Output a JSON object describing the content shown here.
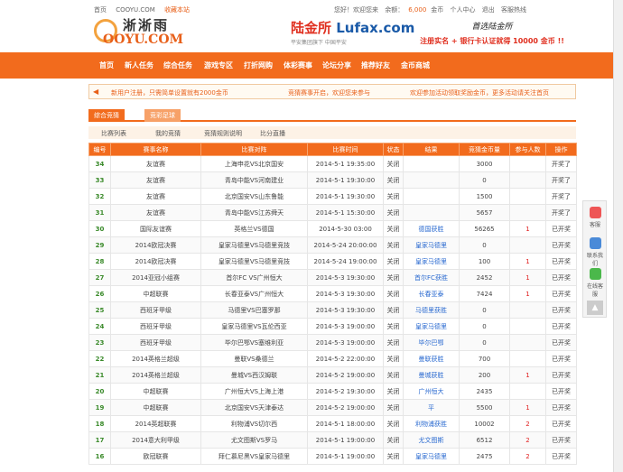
{
  "topbar": {
    "left": [
      "首页",
      "COOYU.COM",
      "收藏本站"
    ],
    "right": [
      "您好！欢迎您来",
      "余额：",
      "6,000",
      "金币",
      "个人中心",
      "退出",
      "客服热线"
    ]
  },
  "logo": {
    "cn": "淅淅雨",
    "en": "OOYU.COM"
  },
  "ad1": {
    "brand_cn": "陆金所",
    "brand_en": "Lufax.com",
    "sub": "平安集团旗下 中国平安"
  },
  "ad2": {
    "title": "首选陆金所",
    "promo": "注册实名 + 银行卡认证就得 10000 金币 !!"
  },
  "nav": [
    "首页",
    "新人任务",
    "综合任务",
    "游戏专区",
    "打折网购",
    "体彩赛事",
    "论坛分享",
    "推荐好友",
    "金币商城"
  ],
  "notice": {
    "items": [
      "新用户注册，只需简单设置就有2000金币",
      "竞猜赛事开启，欢迎您来参与",
      "欢迎参加活动领取奖励金币，更多活动请关注首页"
    ]
  },
  "tabs": [
    "综合竞猜",
    "竞彩足球"
  ],
  "subnav": [
    "比赛列表",
    "我的竞猜",
    "竞猜规则说明",
    "比分直播"
  ],
  "table": {
    "headers": [
      "编号",
      "赛事名称",
      "比赛对阵",
      "比赛时间",
      "状态",
      "结果",
      "竞猜金币量",
      "参与人数",
      "操作"
    ],
    "rows": [
      [
        "34",
        "友谊赛",
        "上海申花VS北京国安",
        "2014-5-1 19:35:00",
        "关闭",
        "",
        "3000",
        "",
        "开奖了"
      ],
      [
        "33",
        "友谊赛",
        "青岛中能VS河南建业",
        "2014-5-1 19:30:00",
        "关闭",
        "",
        "0",
        "",
        "开奖了"
      ],
      [
        "32",
        "友谊赛",
        "北京国安VS山东鲁能",
        "2014-5-1 19:30:00",
        "关闭",
        "",
        "1500",
        "",
        "开奖了"
      ],
      [
        "31",
        "友谊赛",
        "青岛中能VS江苏舜天",
        "2014-5-1 15:30:00",
        "关闭",
        "",
        "5657",
        "",
        "开奖了"
      ],
      [
        "30",
        "国际友谊赛",
        "英格兰VS德国",
        "2014-5-30 03:00",
        "关闭",
        "德国获胜",
        "56265",
        "1",
        "已开奖"
      ],
      [
        "29",
        "2014欧冠决赛",
        "皇家马德里VS马德里竞技",
        "2014-5-24 20:00:00",
        "关闭",
        "皇家马德里",
        "0",
        "",
        "已开奖"
      ],
      [
        "28",
        "2014欧冠决赛",
        "皇家马德里VS马德里竞技",
        "2014-5-24 19:00:00",
        "关闭",
        "皇家马德里",
        "100",
        "1",
        "已开奖"
      ],
      [
        "27",
        "2014亚冠小组赛",
        "首尔FC VS广州恒大",
        "2014-5-3 19:30:00",
        "关闭",
        "首尔FC获胜",
        "2452",
        "1",
        "已开奖"
      ],
      [
        "26",
        "中超联赛",
        "长春亚泰VS广州恒大",
        "2014-5-3 19:30:00",
        "关闭",
        "长春亚泰",
        "7424",
        "1",
        "已开奖"
      ],
      [
        "25",
        "西班牙甲级",
        "马德里VS巴塞罗那",
        "2014-5-3 19:30:00",
        "关闭",
        "马德里获胜",
        "0",
        "",
        "已开奖"
      ],
      [
        "24",
        "西班牙甲级",
        "皇家马德里VS瓦伦西亚",
        "2014-5-3 19:00:00",
        "关闭",
        "皇家马德里",
        "0",
        "",
        "已开奖"
      ],
      [
        "23",
        "西班牙甲级",
        "毕尔巴鄂VS塞维利亚",
        "2014-5-3 19:00:00",
        "关闭",
        "毕尔巴鄂",
        "0",
        "",
        "已开奖"
      ],
      [
        "22",
        "2014英格兰超级",
        "曼联VS桑德兰",
        "2014-5-2 22:00:00",
        "关闭",
        "曼联获胜",
        "700",
        "",
        "已开奖"
      ],
      [
        "21",
        "2014英格兰超级",
        "曼城VS西汉姆联",
        "2014-5-2 19:00:00",
        "关闭",
        "曼城获胜",
        "200",
        "1",
        "已开奖"
      ],
      [
        "20",
        "中超联赛",
        "广州恒大VS上海上港",
        "2014-5-2 19:30:00",
        "关闭",
        "广州恒大",
        "2435",
        "",
        "已开奖"
      ],
      [
        "19",
        "中超联赛",
        "北京国安VS天津泰达",
        "2014-5-2 19:00:00",
        "关闭",
        "平",
        "5500",
        "1",
        "已开奖"
      ],
      [
        "18",
        "2014英超联赛",
        "利物浦VS切尔西",
        "2014-5-1 18:00:00",
        "关闭",
        "利物浦获胜",
        "10002",
        "2",
        "已开奖"
      ],
      [
        "17",
        "2014意大利甲级",
        "尤文图斯VS罗马",
        "2014-5-1 19:00:00",
        "关闭",
        "尤文图斯",
        "6512",
        "2",
        "已开奖"
      ],
      [
        "16",
        "欧冠联赛",
        "拜仁慕尼黑VS皇家马德里",
        "2014-5-1 19:00:00",
        "关闭",
        "皇家马德里",
        "2475",
        "2",
        "已开奖"
      ]
    ]
  },
  "sidebar": {
    "buttons": [
      "客服",
      "联系我们",
      "在线客服"
    ],
    "top": "▲"
  }
}
